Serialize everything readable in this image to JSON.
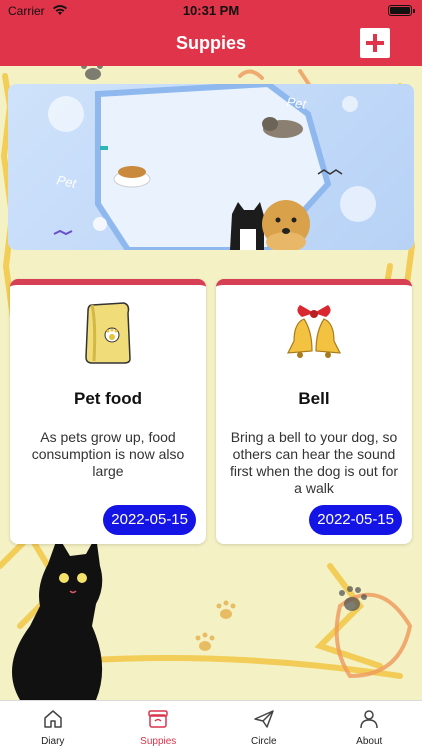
{
  "status_bar": {
    "carrier": "Carrier",
    "time": "10:31 PM"
  },
  "nav": {
    "title": "Suppies",
    "add_icon": "plus-icon"
  },
  "banner": {
    "text_1": "Pet",
    "text_2": "Pet"
  },
  "cards": [
    {
      "icon": "pet-food-bag-icon",
      "title": "Pet food",
      "description": "As pets grow up, food consumption is now also large",
      "date": "2022-05-15"
    },
    {
      "icon": "bell-icon",
      "title": "Bell",
      "description": "Bring a bell to your dog, so others can hear the sound first when the dog is out for a walk",
      "date": "2022-05-15"
    }
  ],
  "tabs": [
    {
      "label": "Diary",
      "icon": "house-icon",
      "active": false
    },
    {
      "label": "Suppies",
      "icon": "box-icon",
      "active": true
    },
    {
      "label": "Circle",
      "icon": "paper-plane-icon",
      "active": false
    },
    {
      "label": "About",
      "icon": "person-icon",
      "active": false
    }
  ],
  "colors": {
    "accent": "#e0344a",
    "date_badge": "#1414e6",
    "active_tab": "#d9344a"
  }
}
